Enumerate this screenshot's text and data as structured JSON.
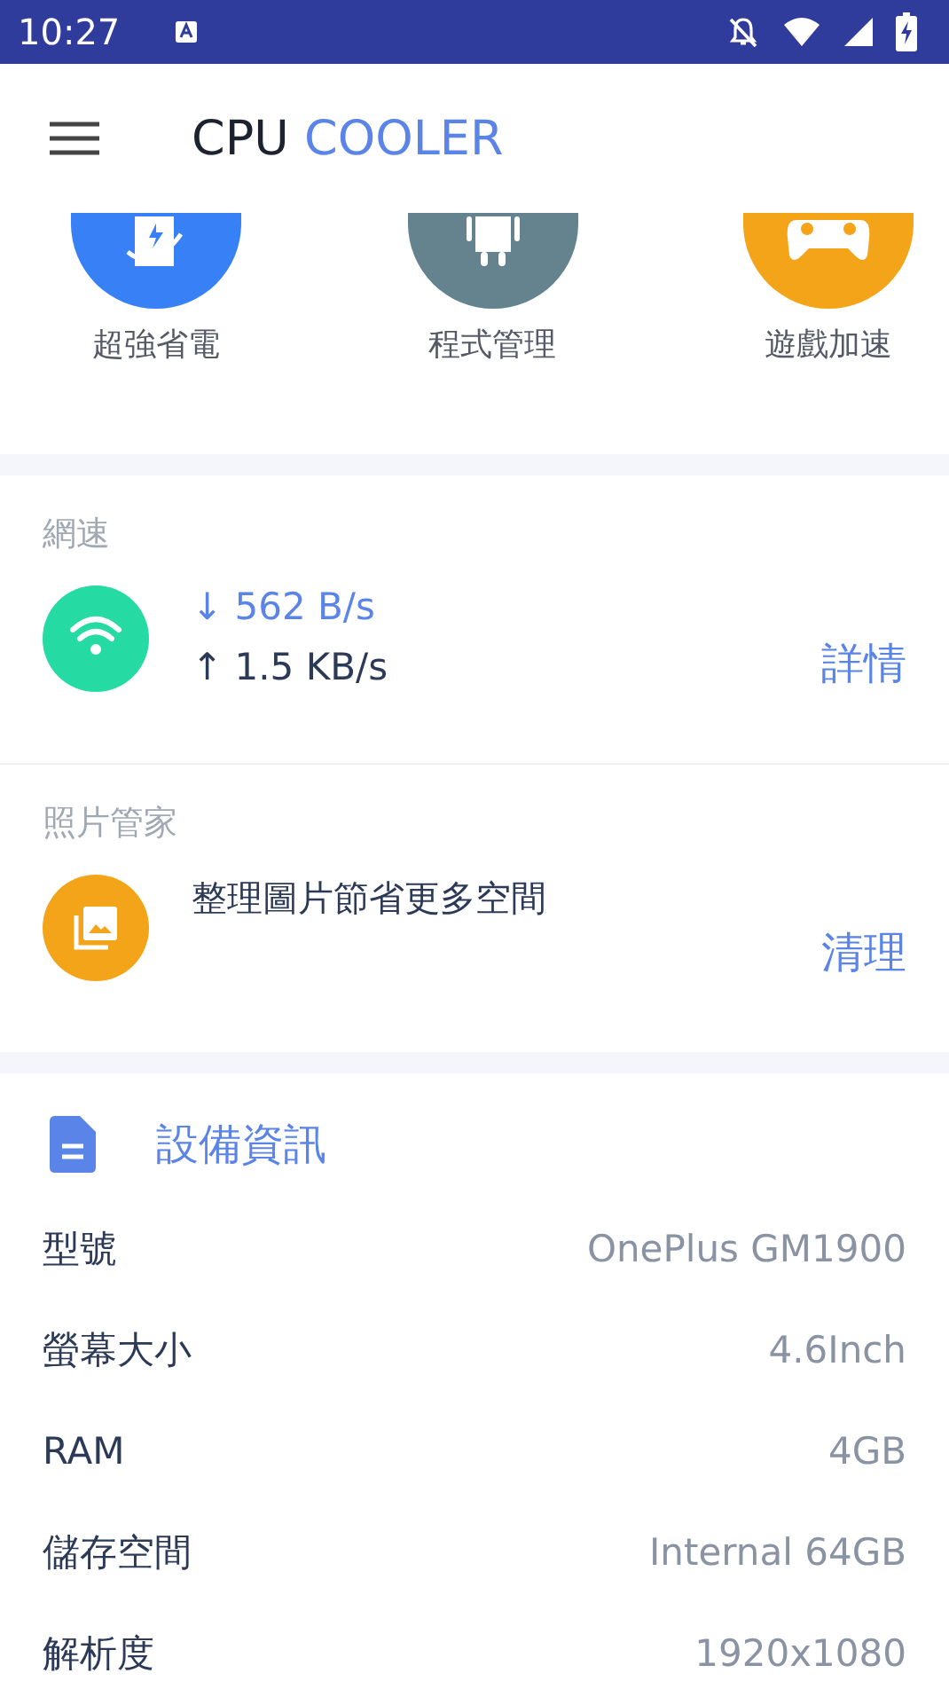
{
  "status_bar": {
    "time": "10:27"
  },
  "app_bar": {
    "title_part_1": "CPU",
    "title_part_2": "COOLER"
  },
  "shortcuts": [
    {
      "kind": "power",
      "label": "超強省電",
      "color": "#3780f5"
    },
    {
      "kind": "apps",
      "label": "程式管理",
      "color": "#64838f"
    },
    {
      "kind": "game",
      "label": "遊戲加速",
      "color": "#f4a418"
    }
  ],
  "network": {
    "heading": "網速",
    "download": "↓ 562 B/s",
    "upload": "↑ 1.5 KB/s",
    "action": "詳情"
  },
  "photos": {
    "heading": "照片管家",
    "message": "整理圖片節省更多空間",
    "action": "清理"
  },
  "device_info": {
    "heading": "設備資訊",
    "rows": [
      {
        "label": "型號",
        "value": "OnePlus GM1900"
      },
      {
        "label": "螢幕大小",
        "value": "4.6Inch"
      },
      {
        "label": "RAM",
        "value": "4GB"
      },
      {
        "label": "儲存空間",
        "value": "Internal 64GB"
      },
      {
        "label": "解析度",
        "value": "1920x1080"
      }
    ]
  }
}
